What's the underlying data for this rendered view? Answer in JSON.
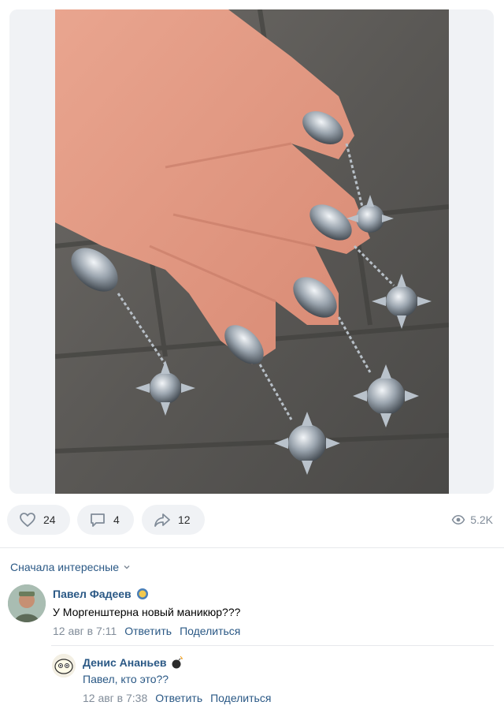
{
  "post": {
    "likes": "24",
    "comments": "4",
    "shares": "12",
    "views": "5.2K"
  },
  "comments_section": {
    "sort_label": "Сначала интересные"
  },
  "comments": [
    {
      "author": "Павел Фадеев",
      "text": "У Моргенштерна новый маникюр???",
      "date": "12 авг в 7:11",
      "reply_label": "Ответить",
      "share_label": "Поделиться"
    },
    {
      "author": "Денис Ананьев",
      "text": "Павел, кто это??",
      "date": "12 авг в 7:38",
      "reply_label": "Ответить",
      "share_label": "Поделиться"
    }
  ],
  "colors": {
    "link": "#2a5885",
    "muted": "#818c99",
    "pill_bg": "#f0f2f5"
  }
}
